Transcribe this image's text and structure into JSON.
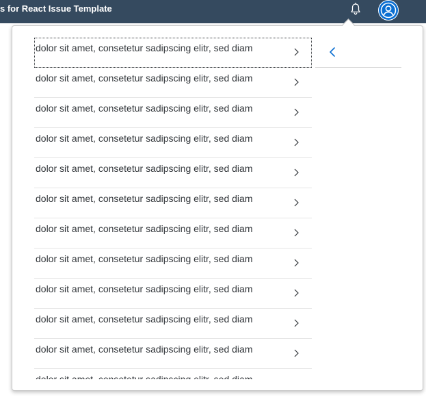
{
  "shellbar": {
    "title": "s for React Issue Template",
    "notifications_icon": "bell-icon",
    "avatar_icon": "user-avatar-icon",
    "bg_color": "#354a5f"
  },
  "popover": {
    "list": {
      "items": [
        {
          "text": "dolor sit amet, consetetur sadipscing elitr, sed diam"
        },
        {
          "text": "dolor sit amet, consetetur sadipscing elitr, sed diam"
        },
        {
          "text": "dolor sit amet, consetetur sadipscing elitr, sed diam"
        },
        {
          "text": "dolor sit amet, consetetur sadipscing elitr, sed diam"
        },
        {
          "text": "dolor sit amet, consetetur sadipscing elitr, sed diam"
        },
        {
          "text": "dolor sit amet, consetetur sadipscing elitr, sed diam"
        },
        {
          "text": "dolor sit amet, consetetur sadipscing elitr, sed diam"
        },
        {
          "text": "dolor sit amet, consetetur sadipscing elitr, sed diam"
        },
        {
          "text": "dolor sit amet, consetetur sadipscing elitr, sed diam"
        },
        {
          "text": "dolor sit amet, consetetur sadipscing elitr, sed diam"
        },
        {
          "text": "dolor sit amet, consetetur sadipscing elitr, sed diam"
        },
        {
          "text": "dolor sit amet, consetetur sadipscing elitr, sed diam"
        }
      ],
      "item_icon": "chevron-right-icon"
    },
    "detail": {
      "back_icon": "chevron-left-icon",
      "accent_color": "#0a6ed1"
    }
  }
}
